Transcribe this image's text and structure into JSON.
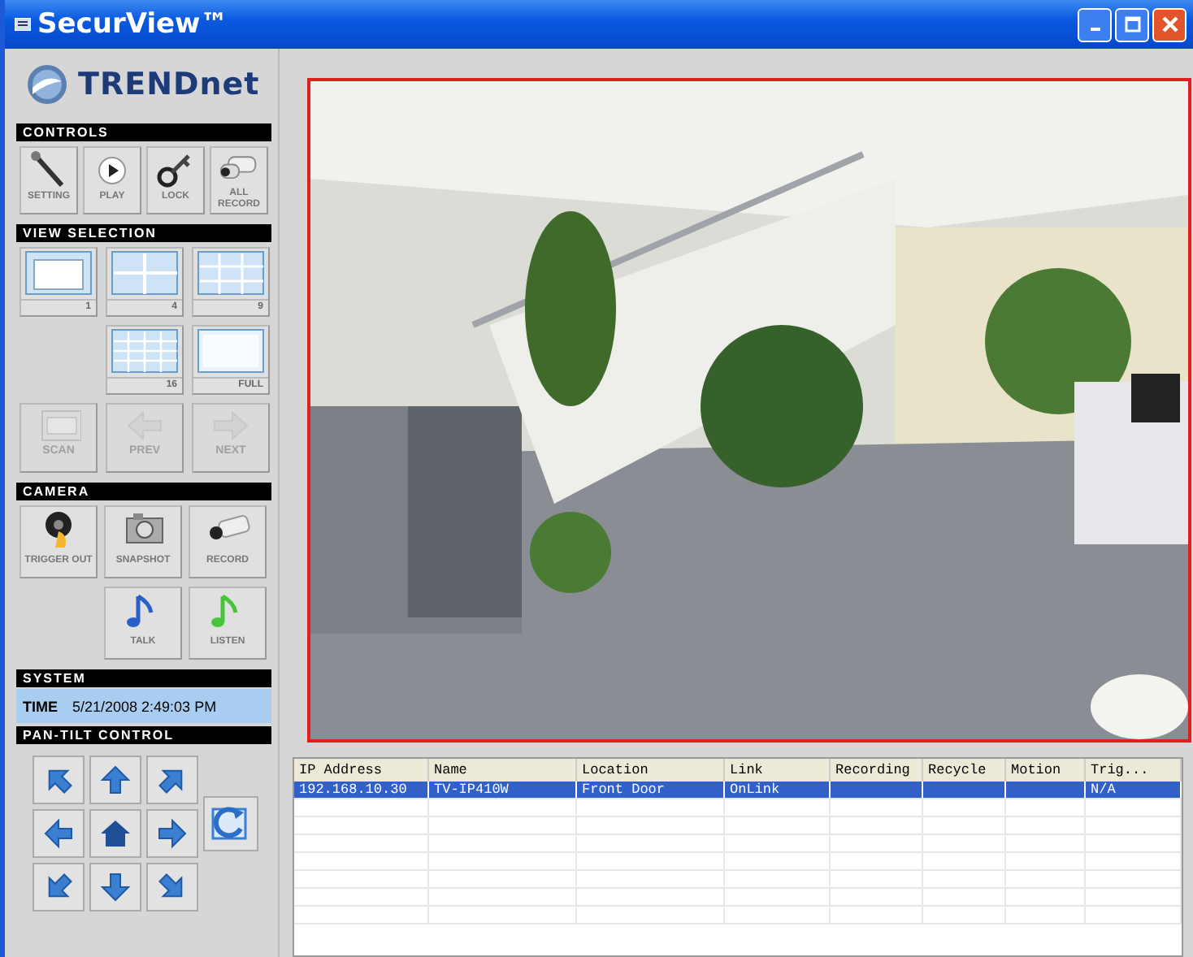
{
  "window": {
    "title": "SecurView™"
  },
  "logo": {
    "text": "TRENDnet"
  },
  "controls": {
    "title": "CONTROLS",
    "buttons": [
      {
        "label": "SETTING",
        "disabled": false
      },
      {
        "label": "PLAY",
        "disabled": false
      },
      {
        "label": "LOCK",
        "disabled": false
      },
      {
        "label": "ALL RECORD",
        "disabled": false
      }
    ]
  },
  "view_selection": {
    "title": "VIEW SELECTION",
    "buttons": [
      {
        "label": "1",
        "disabled": false
      },
      {
        "label": "4",
        "disabled": false
      },
      {
        "label": "9",
        "disabled": false
      },
      {
        "label": "16",
        "disabled": false
      },
      {
        "label": "FULL",
        "disabled": false
      },
      {
        "label": "SCAN",
        "disabled": true
      },
      {
        "label": "PREV",
        "disabled": true
      },
      {
        "label": "NEXT",
        "disabled": true
      }
    ]
  },
  "camera": {
    "title": "CAMERA",
    "buttons": [
      {
        "label": "TRIGGER OUT",
        "disabled": false
      },
      {
        "label": "SNAPSHOT",
        "disabled": false
      },
      {
        "label": "RECORD",
        "disabled": false
      },
      {
        "label": "TALK",
        "disabled": false
      },
      {
        "label": "LISTEN",
        "disabled": false
      }
    ]
  },
  "system": {
    "title": "SYSTEM",
    "time_label": "TIME",
    "time": "5/21/2008 2:49:03 PM"
  },
  "pan_tilt": {
    "title": "PAN-TILT CONTROL"
  },
  "table": {
    "columns": [
      "IP Address",
      "Name",
      "Location",
      "Link",
      "Recording",
      "Recycle",
      "Motion",
      "Trig..."
    ],
    "rows": [
      {
        "cells": [
          "192.168.10.30",
          "TV-IP410W",
          "Front Door",
          "OnLink",
          "",
          "",
          "",
          "N/A"
        ],
        "selected": true
      }
    ]
  }
}
